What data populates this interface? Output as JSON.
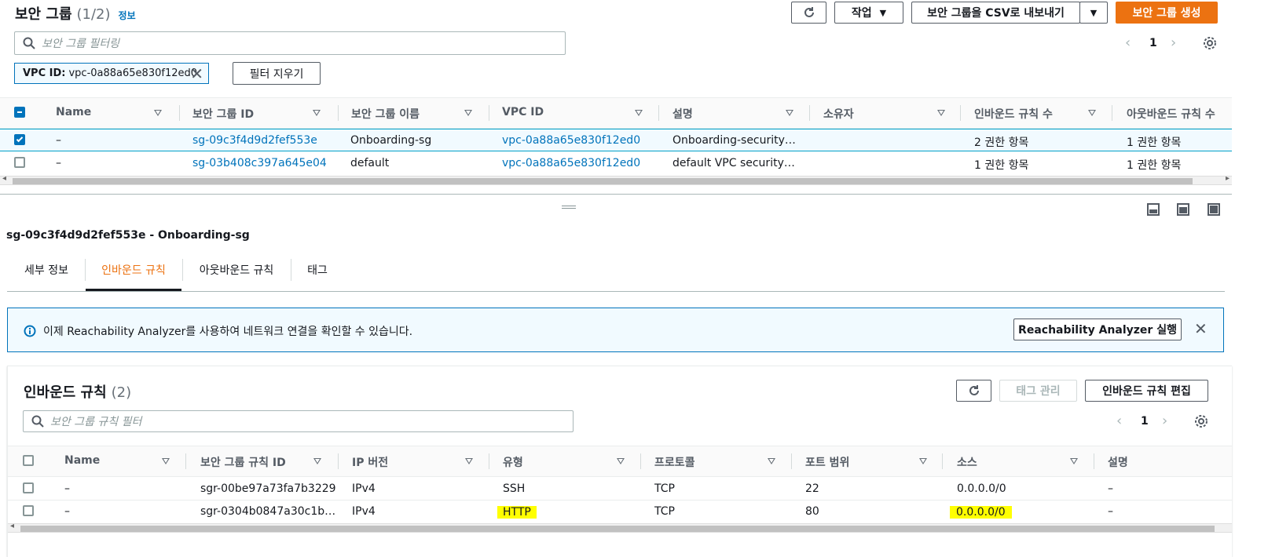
{
  "header": {
    "title": "보안 그룹",
    "count": "(1/2)",
    "info": "정보",
    "actions_label": "작업",
    "export_label": "보안 그룹을 CSV로 내보내기",
    "create_label": "보안 그룹 생성",
    "filter_placeholder": "보안 그룹 필터링",
    "page": "1",
    "chip_key": "VPC ID:",
    "chip_value": "vpc-0a88a65e830f12ed0",
    "clear_filters": "필터 지우기"
  },
  "sg_table": {
    "columns": [
      "Name",
      "보안 그룹 ID",
      "보안 그룹 이름",
      "VPC ID",
      "설명",
      "소유자",
      "인바운드 규칙 수",
      "아웃바운드 규칙 수"
    ],
    "rows": [
      {
        "name": "–",
        "id": "sg-09c3f4d9d2fef553e",
        "group_name": "Onboarding-sg",
        "vpc": "vpc-0a88a65e830f12ed0",
        "desc": "Onboarding-security g…",
        "owner": "",
        "inbound": "2 권한 항목",
        "outbound": "1 권한 항목",
        "selected": true
      },
      {
        "name": "–",
        "id": "sg-03b408c397a645e04",
        "group_name": "default",
        "vpc": "vpc-0a88a65e830f12ed0",
        "desc": "default VPC security gr…",
        "owner": "",
        "inbound": "1 권한 항목",
        "outbound": "1 권한 항목",
        "selected": false
      }
    ]
  },
  "detail": {
    "title": "sg-09c3f4d9d2fef553e - Onboarding-sg",
    "tabs": [
      "세부 정보",
      "인바운드 규칙",
      "아웃바운드 규칙",
      "태그"
    ],
    "active_tab": "인바운드 규칙",
    "banner_text": "이제 Reachability Analyzer를 사용하여 네트워크 연결을 확인할 수 있습니다.",
    "banner_button": "Reachability Analyzer 실행"
  },
  "inbound": {
    "title": "인바운드 규칙",
    "count": "(2)",
    "manage_tags": "태그 관리",
    "edit_label": "인바운드 규칙 편집",
    "filter_placeholder": "보안 그룹 규칙 필터",
    "page": "1",
    "columns": [
      "Name",
      "보안 그룹 규칙 ID",
      "IP 버전",
      "유형",
      "프로토콜",
      "포트 범위",
      "소스",
      "설명"
    ],
    "rows": [
      {
        "name": "–",
        "id": "sgr-00be97a73fa7b3229",
        "ip": "IPv4",
        "type": "SSH",
        "protocol": "TCP",
        "port": "22",
        "source": "0.0.0.0/0",
        "desc": "–"
      },
      {
        "name": "–",
        "id": "sgr-0304b0847a30c1b…",
        "ip": "IPv4",
        "type": "HTTP",
        "protocol": "TCP",
        "port": "80",
        "source": "0.0.0.0/0",
        "desc": "–"
      }
    ]
  },
  "colors": {
    "accent_orange": "#ec7211",
    "link_blue": "#0073bb",
    "highlight": "#ffff00"
  }
}
